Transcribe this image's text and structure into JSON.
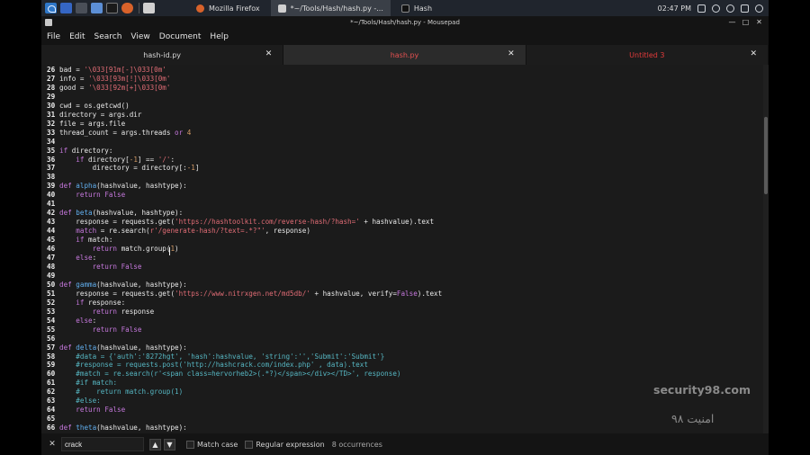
{
  "taskbar": {
    "tasks": [
      {
        "label": "Mozilla Firefox"
      },
      {
        "label": "*~/Tools/Hash/hash.py -..."
      },
      {
        "label": "Hash"
      }
    ],
    "time": "02:47 PM"
  },
  "window": {
    "title": "*~/Tools/Hash/hash.py - Mousepad",
    "close_glyph": "✕",
    "max_glyph": "□",
    "min_glyph": "—"
  },
  "menu": [
    "File",
    "Edit",
    "Search",
    "View",
    "Document",
    "Help"
  ],
  "tabs": [
    {
      "label": "hash-id.py",
      "close": "✕"
    },
    {
      "label": "hash.py",
      "close": "✕"
    },
    {
      "label": "Untitled 3",
      "close": "✕"
    }
  ],
  "watermark": {
    "en": "security98.com",
    "fa": "امنیت ۹۸"
  },
  "search": {
    "close": "✕",
    "value": "crack",
    "up": "▲",
    "down": "▼",
    "match_case": "Match case",
    "regex": "Regular expression",
    "occurrences": "8 occurrences"
  },
  "colors": {
    "accent_red": "#e35050",
    "keyword": "#c678dd",
    "string": "#e06c75",
    "bg": "#1b1b1b"
  }
}
